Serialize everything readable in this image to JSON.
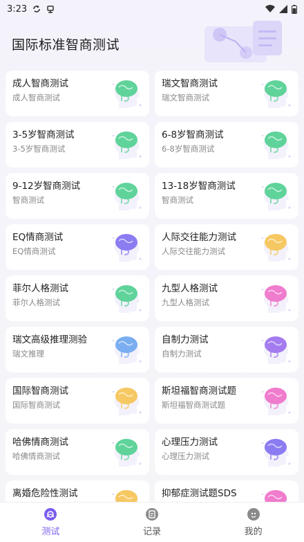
{
  "status_bar": {
    "time": "3:23"
  },
  "header": {
    "title": "国际标准智商测试"
  },
  "tests": [
    {
      "title": "成人智商测试",
      "subtitle": "成人智商测试",
      "icon": "brain-green-icon",
      "color": "#5fd39a"
    },
    {
      "title": "瑞文智商测试",
      "subtitle": "瑞文智商测试",
      "icon": "brain-green-icon",
      "color": "#5fd39a"
    },
    {
      "title": "3-5岁智商测试",
      "subtitle": "3-5岁智商测试",
      "icon": "brain-green-icon",
      "color": "#5fd39a"
    },
    {
      "title": "6-8岁智商测试",
      "subtitle": "6-8岁智商测试",
      "icon": "brain-green-icon",
      "color": "#5fd39a"
    },
    {
      "title": "9-12岁智商测试",
      "subtitle": "智商测试",
      "icon": "brain-green-icon",
      "color": "#5fd39a"
    },
    {
      "title": "13-18岁智商测试",
      "subtitle": "智商测试",
      "icon": "brain-green-icon",
      "color": "#5fd39a"
    },
    {
      "title": "EQ情商测试",
      "subtitle": "EQ情商测试",
      "icon": "brain-purple-icon",
      "color": "#8b7cf2"
    },
    {
      "title": "人际交往能力测试",
      "subtitle": "人际交往能力测试",
      "icon": "brain-yellow-icon",
      "color": "#f6c862"
    },
    {
      "title": "菲尔人格测试",
      "subtitle": "菲尔人格测试",
      "icon": "brain-green-icon",
      "color": "#5fd39a"
    },
    {
      "title": "九型人格测试",
      "subtitle": "九型人格测试",
      "icon": "brain-pink-icon",
      "color": "#f07ccd"
    },
    {
      "title": "瑞文高级推理测验",
      "subtitle": "瑞文推理",
      "icon": "brain-blue-icon",
      "color": "#7aaef0"
    },
    {
      "title": "自制力测试",
      "subtitle": "自制力测试",
      "icon": "brain-violet-icon",
      "color": "#a47cf0"
    },
    {
      "title": "国际智商测试",
      "subtitle": "国际智商测试",
      "icon": "brain-yellow-icon",
      "color": "#f6c862"
    },
    {
      "title": "斯坦福智商测试题",
      "subtitle": "斯坦福智商测试题",
      "icon": "brain-pink-icon",
      "color": "#f07ccd"
    },
    {
      "title": "哈佛情商测试",
      "subtitle": "哈佛情商测试",
      "icon": "brain-green-icon",
      "color": "#5fd39a"
    },
    {
      "title": "心理压力测试",
      "subtitle": "心理压力测试",
      "icon": "brain-purple-icon",
      "color": "#8b7cf2"
    },
    {
      "title": "离婚危险性测试",
      "subtitle": "",
      "icon": "brain-yellow-icon",
      "color": "#f6c862"
    },
    {
      "title": "抑郁症测试题SDS",
      "subtitle": "",
      "icon": "brain-pink-icon",
      "color": "#f07ccd"
    }
  ],
  "tabs": [
    {
      "label": "测试",
      "icon": "test-icon",
      "active": true
    },
    {
      "label": "记录",
      "icon": "record-icon",
      "active": false
    },
    {
      "label": "我的",
      "icon": "profile-icon",
      "active": false
    }
  ],
  "colors": {
    "accent": "#7a5cf0"
  }
}
